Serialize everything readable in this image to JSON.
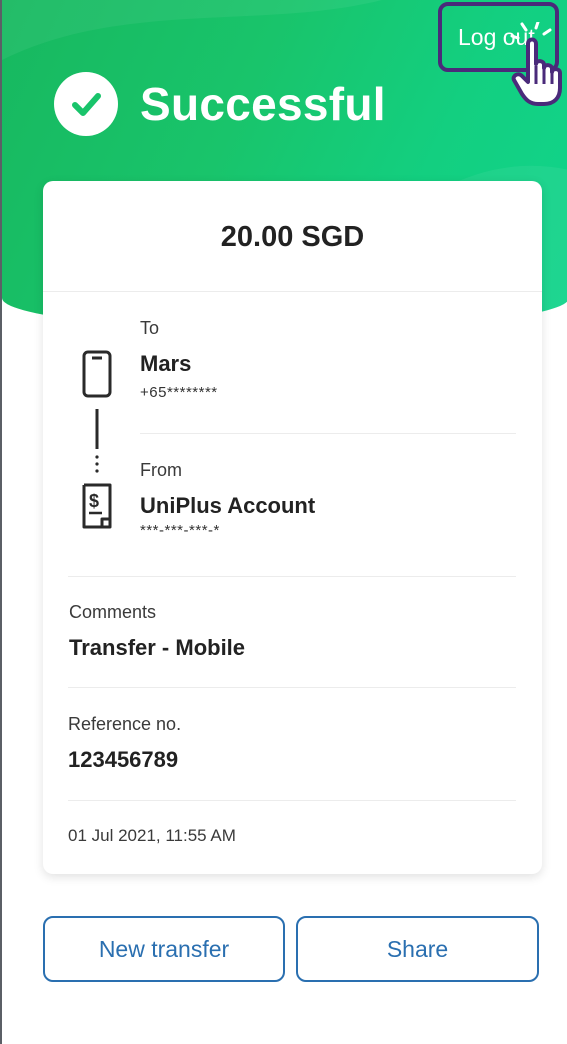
{
  "header": {
    "status_title": "Successful",
    "logout_label": "Log out"
  },
  "receipt": {
    "amount": "20.00 SGD",
    "to_label": "To",
    "to_name": "Mars",
    "to_number": "+65********",
    "from_label": "From",
    "from_name": "UniPlus Account",
    "from_account": "***-***-***-*",
    "comments_label": "Comments",
    "comments_value": "Transfer - Mobile",
    "reference_label": "Reference no.",
    "reference_value": "123456789",
    "timestamp": "01 Jul 2021, 11:55 AM"
  },
  "actions": {
    "new_transfer_label": "New transfer",
    "share_label": "Share"
  },
  "colors": {
    "header_green": "#19c46b",
    "accent_blue": "#2a6fb0",
    "highlight_purple": "#4a2a7a"
  },
  "icons": [
    "check-icon",
    "phone-icon",
    "account-statement-icon",
    "hand-pointer-icon"
  ]
}
